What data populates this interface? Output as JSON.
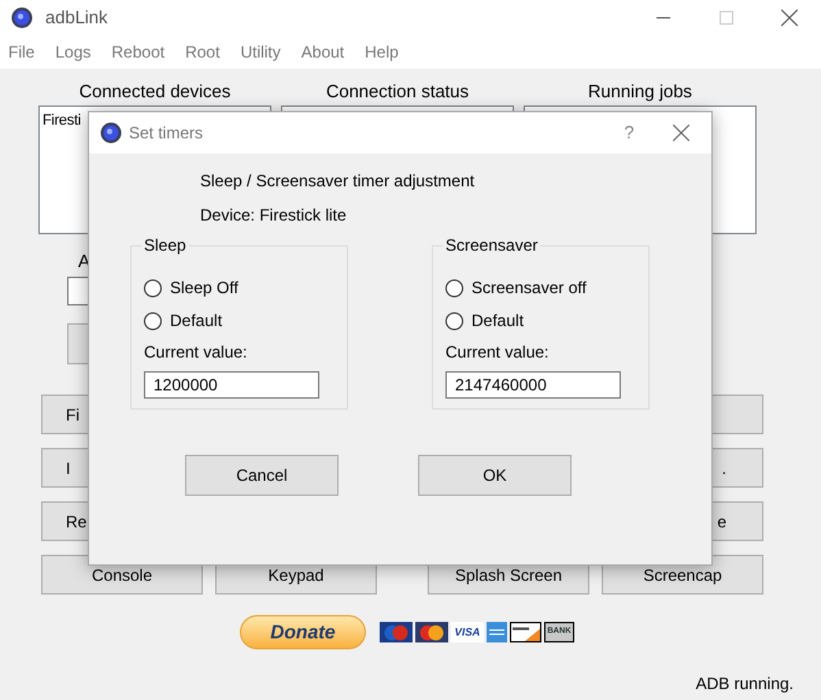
{
  "window": {
    "title": "adbLink"
  },
  "menu": [
    "File",
    "Logs",
    "Reboot",
    "Root",
    "Utility",
    "About",
    "Help"
  ],
  "panels": [
    {
      "header": "Connected devices",
      "items": [
        "Firesti"
      ]
    },
    {
      "header": "Connection status"
    },
    {
      "header": "Running jobs"
    }
  ],
  "address_label": "A",
  "side_buttons": [
    {
      "left": "Fi"
    },
    {
      "left": "I",
      "right": "."
    },
    {
      "left": "Re",
      "right": "e"
    }
  ],
  "bottom_buttons": [
    "Console",
    "Keypad",
    "Splash Screen",
    "Screencap"
  ],
  "donate": "Donate",
  "payment_cards": [
    {
      "kind": "maestro"
    },
    {
      "kind": "mastercard"
    },
    {
      "kind": "visa",
      "label": "VISA"
    },
    {
      "kind": "amex"
    },
    {
      "kind": "discover"
    },
    {
      "kind": "bank",
      "label": "BANK"
    }
  ],
  "status_bar": "ADB running.",
  "dialog": {
    "title": "Set timers",
    "help": "?",
    "heading": "Sleep / Screensaver timer adjustment",
    "device": "Device: Firestick lite",
    "groups": [
      {
        "title": "Sleep",
        "options": [
          {
            "label": "Sleep Off",
            "selected": false
          },
          {
            "label": "Default",
            "selected": false
          }
        ],
        "value_label": "Current value:",
        "value": "1200000"
      },
      {
        "title": "Screensaver",
        "options": [
          {
            "label": "Screensaver off",
            "selected": false
          },
          {
            "label": "Default",
            "selected": false
          }
        ],
        "value_label": "Current value:",
        "value": "2147460000"
      }
    ],
    "buttons": [
      "Cancel",
      "OK"
    ]
  }
}
